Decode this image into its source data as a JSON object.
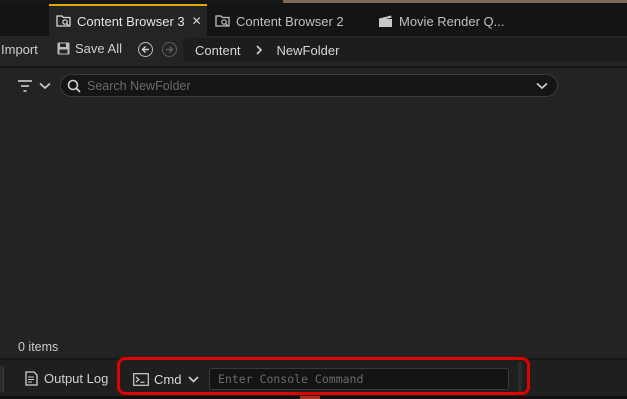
{
  "tabs": [
    {
      "label": "Content Browser 3",
      "icon": "folder-search-icon",
      "active": true,
      "closable": true
    },
    {
      "label": "Content Browser 2",
      "icon": "folder-search-icon",
      "active": false
    },
    {
      "label": "Movie Render Q...",
      "icon": "clapperboard-icon",
      "active": false
    }
  ],
  "toolbar": {
    "import_label": "Import",
    "save_all_label": "Save All"
  },
  "breadcrumb": {
    "items": [
      "Content",
      "NewFolder"
    ]
  },
  "search": {
    "placeholder": "Search NewFolder",
    "value": ""
  },
  "status": {
    "item_count": "0 items"
  },
  "bottom": {
    "output_log_label": "Output Log",
    "cmd_label": "Cmd",
    "console_placeholder": "Enter Console Command"
  },
  "colors": {
    "highlight": "#e00000",
    "active_tab_accent": "#e0a800",
    "background": "#232323"
  }
}
